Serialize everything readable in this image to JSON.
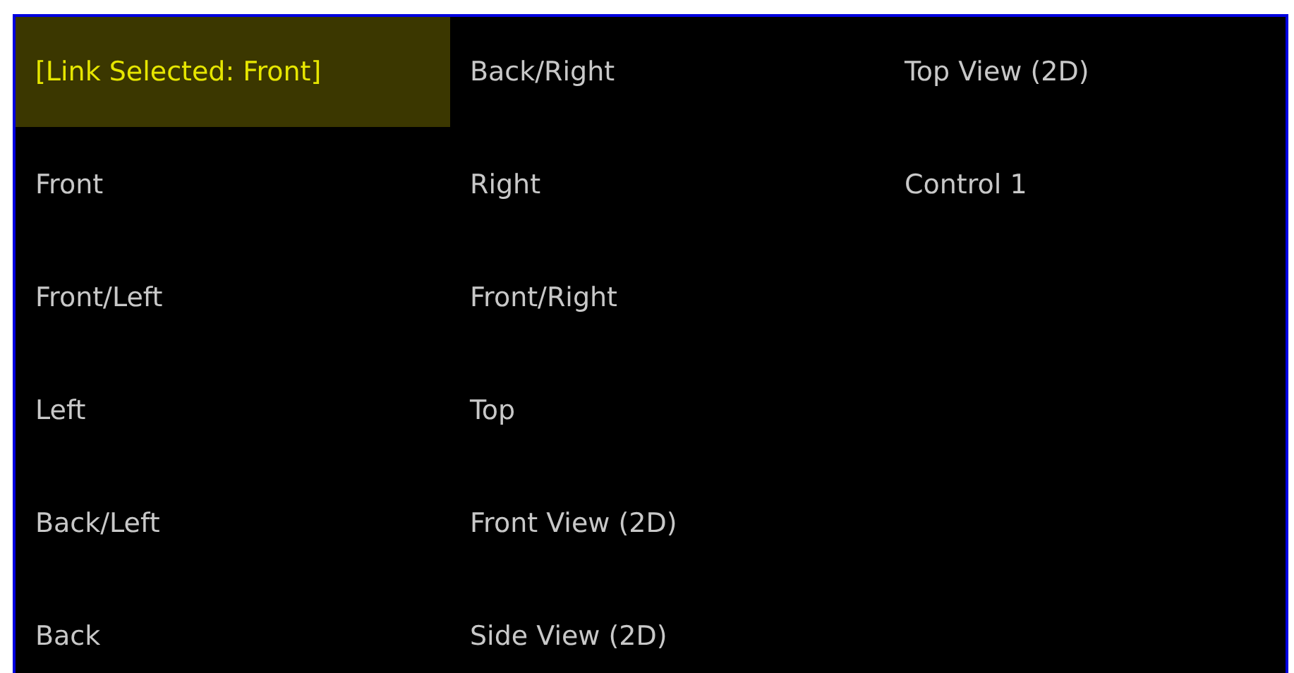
{
  "items": [
    {
      "label": "[Link Selected: Front]",
      "selected": true
    },
    {
      "label": "Front",
      "selected": false
    },
    {
      "label": "Front/Left",
      "selected": false
    },
    {
      "label": "Left",
      "selected": false
    },
    {
      "label": "Back/Left",
      "selected": false
    },
    {
      "label": "Back",
      "selected": false
    },
    {
      "label": "Back/Right",
      "selected": false
    },
    {
      "label": "Right",
      "selected": false
    },
    {
      "label": "Front/Right",
      "selected": false
    },
    {
      "label": "Top",
      "selected": false
    },
    {
      "label": "Front View (2D)",
      "selected": false
    },
    {
      "label": "Side View (2D)",
      "selected": false
    },
    {
      "label": "Top View (2D)",
      "selected": false
    },
    {
      "label": "Control 1",
      "selected": false
    }
  ]
}
